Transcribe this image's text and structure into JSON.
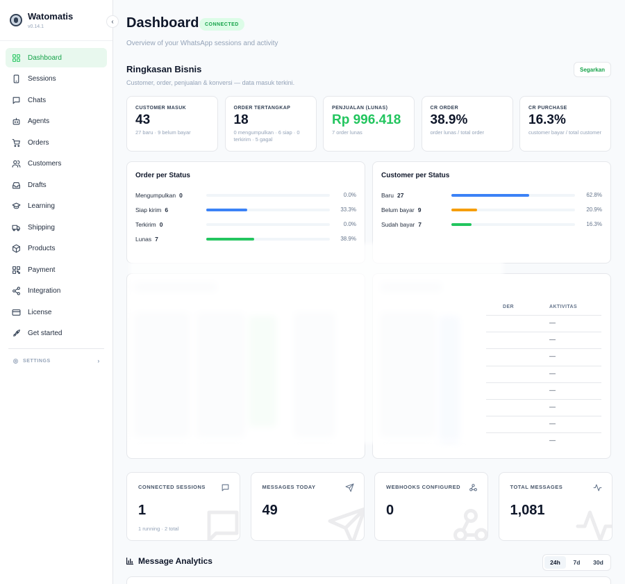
{
  "app": {
    "name": "Watomatis",
    "version": "v0.14.1"
  },
  "sidebar": {
    "items": [
      {
        "label": "Dashboard",
        "icon": "dashboard-icon",
        "active": true
      },
      {
        "label": "Sessions",
        "icon": "phone-icon"
      },
      {
        "label": "Chats",
        "icon": "chat-icon"
      },
      {
        "label": "Agents",
        "icon": "robot-icon"
      },
      {
        "label": "Orders",
        "icon": "cart-icon"
      },
      {
        "label": "Customers",
        "icon": "users-icon"
      },
      {
        "label": "Drafts",
        "icon": "inbox-icon"
      },
      {
        "label": "Learning",
        "icon": "graduation-cap-icon"
      },
      {
        "label": "Shipping",
        "icon": "truck-icon"
      },
      {
        "label": "Products",
        "icon": "box-icon"
      },
      {
        "label": "Payment",
        "icon": "qr-code-icon"
      },
      {
        "label": "Integration",
        "icon": "share-icon"
      },
      {
        "label": "License",
        "icon": "credit-card-icon"
      },
      {
        "label": "Get started",
        "icon": "rocket-icon"
      }
    ],
    "settings_label": "SETTINGS"
  },
  "header": {
    "title": "Dashboard",
    "status_badge": "CONNECTED",
    "subtitle": "Overview of your WhatsApp sessions and activity"
  },
  "summary": {
    "title": "Ringkasan Bisnis",
    "subtitle": "Customer, order, penjualan & konversi — data masuk terkini.",
    "refresh_label": "Segarkan"
  },
  "kpis": [
    {
      "label": "CUSTOMER MASUK",
      "value": "43",
      "note": "27 baru · 9 belum bayar"
    },
    {
      "label": "ORDER TERTANGKAP",
      "value": "18",
      "note": "0 mengumpulkan · 6 siap · 0 terkirim · 5 gagal"
    },
    {
      "label": "PENJUALAN (LUNAS)",
      "value": "Rp 996.418",
      "note": "7 order lunas"
    },
    {
      "label": "CR ORDER",
      "value": "38.9%",
      "note": "order lunas / total order"
    },
    {
      "label": "CR PURCHASE",
      "value": "16.3%",
      "note": "customer bayar / total customer"
    }
  ],
  "order_status": {
    "title": "Order per Status",
    "rows": [
      {
        "label": "Mengumpulkan",
        "count": "0",
        "pct_label": "0.0%",
        "pct": 0.0,
        "color": "#94a3b8"
      },
      {
        "label": "Siap kirim",
        "count": "6",
        "pct_label": "33.3%",
        "pct": 33.3,
        "color": "#3b82f6"
      },
      {
        "label": "Terkirim",
        "count": "0",
        "pct_label": "0.0%",
        "pct": 0.0,
        "color": "#94a3b8"
      },
      {
        "label": "Lunas",
        "count": "7",
        "pct_label": "38.9%",
        "pct": 38.9,
        "color": "#22c55e"
      }
    ]
  },
  "customer_status": {
    "title": "Customer per Status",
    "rows": [
      {
        "label": "Baru",
        "count": "27",
        "pct_label": "62.8%",
        "pct": 62.8,
        "color": "#3b82f6"
      },
      {
        "label": "Belum bayar",
        "count": "9",
        "pct_label": "20.9%",
        "pct": 20.9,
        "color": "#f59e0b"
      },
      {
        "label": "Sudah bayar",
        "count": "7",
        "pct_label": "16.3%",
        "pct": 16.3,
        "color": "#22c55e"
      }
    ]
  },
  "activity_table": {
    "col_order": "DER",
    "col_activity": "AKTIVITAS",
    "dash": "—"
  },
  "stats": [
    {
      "label": "CONNECTED SESSIONS",
      "value": "1",
      "note": "1 running · 2 total",
      "icon": "message-square-icon"
    },
    {
      "label": "MESSAGES TODAY",
      "value": "49",
      "note": "",
      "icon": "send-icon"
    },
    {
      "label": "WEBHOOKS CONFIGURED",
      "value": "0",
      "note": "",
      "icon": "webhook-icon"
    },
    {
      "label": "TOTAL MESSAGES",
      "value": "1,081",
      "note": "",
      "icon": "activity-icon"
    }
  ],
  "analytics": {
    "title": "Message Analytics",
    "ranges": [
      "24h",
      "7d",
      "30d"
    ],
    "active_range": "24h"
  },
  "colors": {
    "accent": "#22c55e",
    "accent_soft": "#e8f8ee",
    "blue": "#3b82f6",
    "amber": "#f59e0b"
  }
}
